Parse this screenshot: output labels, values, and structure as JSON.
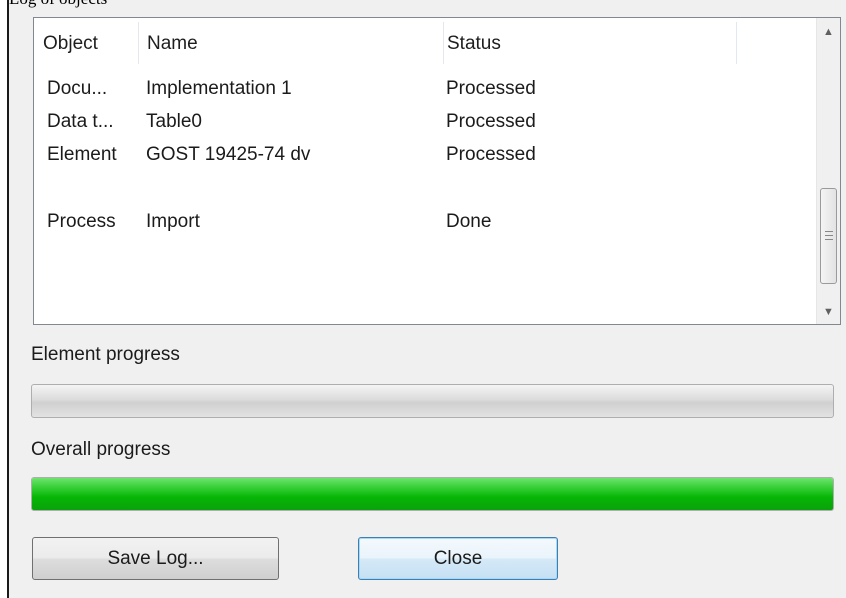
{
  "window": {
    "title_fragment": "Log of objects"
  },
  "log_list": {
    "columns": [
      "Object",
      "Name",
      "Status"
    ],
    "rows": [
      {
        "object": "Docu...",
        "name": "Implementation 1",
        "status": "Processed"
      },
      {
        "object": "Data t...",
        "name": "Table0",
        "status": "Processed"
      },
      {
        "object": "Element",
        "name": "GOST 19425-74 dv",
        "status": "Processed"
      },
      {
        "object": "",
        "name": "",
        "status": ""
      },
      {
        "object": "Process",
        "name": "Import",
        "status": "Done"
      }
    ],
    "scrollbar": {
      "up_icon": "arrow-up-icon",
      "down_icon": "arrow-down-icon",
      "grip_icon": "grip-icon"
    }
  },
  "element_progress": {
    "label": "Element progress",
    "value": 0
  },
  "overall_progress": {
    "label": "Overall progress",
    "value": 1.0,
    "fill_color": "#06b606"
  },
  "buttons": {
    "save_log": "Save Log...",
    "close": "Close"
  },
  "colors": {
    "dialog_background": "#f0f0f0",
    "list_background": "#ffffff",
    "default_button_border": "#3c7fb1"
  }
}
